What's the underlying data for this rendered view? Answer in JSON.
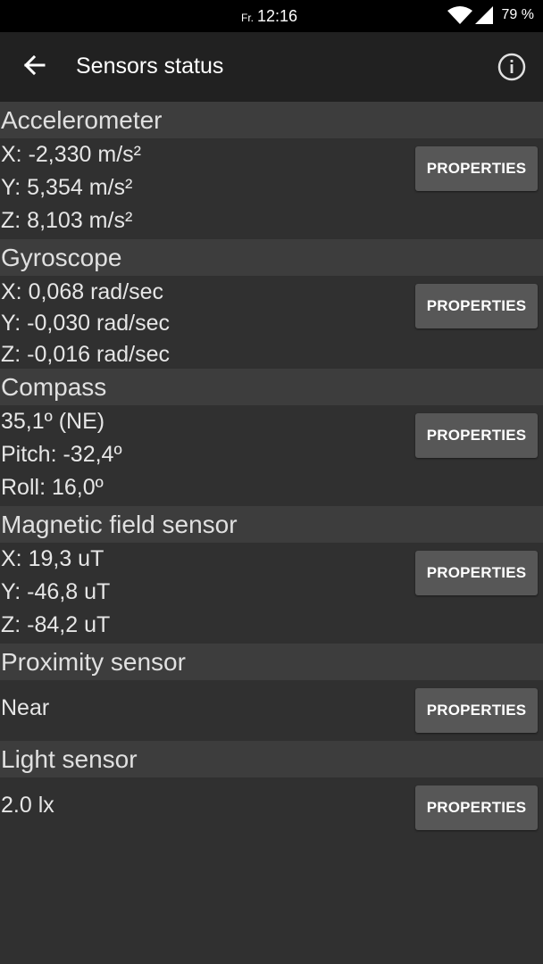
{
  "status_bar": {
    "day": "Fr.",
    "time": "12:16",
    "battery": "79 %",
    "icons": [
      "wifi-icon",
      "signal-icon"
    ]
  },
  "app_bar": {
    "title": "Sensors status",
    "back_icon": "arrow-back-icon",
    "info_icon": "info-icon"
  },
  "colors": {
    "status_bar": "#000000",
    "app_bar": "#212121",
    "background": "#303030",
    "section_header": "#3d3d3d",
    "button": "#575757"
  },
  "sensors": [
    {
      "name": "Accelerometer",
      "values": [
        "X: -2,330 m/s²",
        "Y: 5,354 m/s²",
        "Z: 8,103 m/s²"
      ],
      "button": "PROPERTIES"
    },
    {
      "name": "Gyroscope",
      "values": [
        "X: 0,068 rad/sec",
        "Y: -0,030 rad/sec",
        "Z: -0,016 rad/sec"
      ],
      "button": "PROPERTIES"
    },
    {
      "name": "Compass",
      "values": [
        "35,1º (NE)",
        "Pitch: -32,4º",
        "Roll: 16,0º"
      ],
      "button": "PROPERTIES"
    },
    {
      "name": "Magnetic field sensor",
      "values": [
        "X: 19,3 uT",
        "Y: -46,8 uT",
        "Z: -84,2 uT"
      ],
      "button": "PROPERTIES"
    },
    {
      "name": "Proximity sensor",
      "values": [
        "Near"
      ],
      "button": "PROPERTIES"
    },
    {
      "name": "Light sensor",
      "values": [
        "2.0 lx"
      ],
      "button": "PROPERTIES"
    }
  ]
}
